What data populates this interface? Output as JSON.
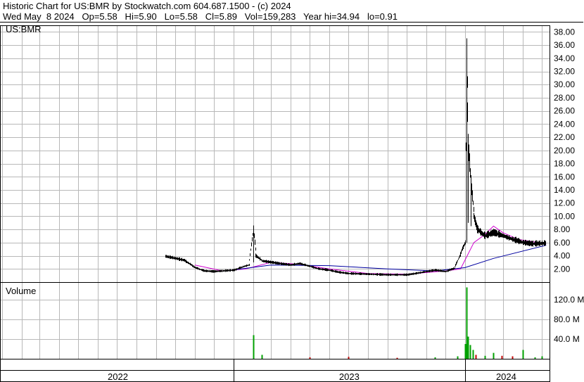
{
  "header": {
    "line1": "Historic Chart for US:BMR by Stockwatch.com 604.687.1500 - (c) 2024",
    "line2": "Wed May  8 2024   Op=5.58   Hi=5.90   Lo=5.58   Cl=5.89   Vol=159,283   Year hi=34.94   lo=0.91"
  },
  "price_panel": {
    "symbol_label": "US:BMR"
  },
  "volume_panel": {
    "label": "Volume"
  },
  "years": [
    "2022",
    "2023",
    "2024"
  ],
  "colors": {
    "price_bar": "#000000",
    "ma_short": "#d000d0",
    "ma_long": "#0000a0",
    "vol_up": "#00a000",
    "vol_down": "#c00000",
    "grid": "#b8b8b8"
  },
  "chart_data": [
    {
      "type": "bar",
      "title": "US:BMR",
      "subtype": "ohlc",
      "ylim": [
        0,
        39
      ],
      "yticks": [
        2.0,
        4.0,
        6.0,
        8.0,
        10.0,
        12.0,
        14.0,
        16.0,
        18.0,
        20.0,
        22.0,
        24.0,
        26.0,
        28.0,
        30.0,
        32.0,
        34.0,
        36.0,
        38.0
      ],
      "ytick_labels": [
        "2.00",
        "4.00",
        "6.00",
        "8.00",
        "10.00",
        "12.00",
        "14.00",
        "16.00",
        "18.00",
        "20.00",
        "22.00",
        "24.00",
        "26.00",
        "28.00",
        "30.00",
        "32.00",
        "34.00",
        "36.00",
        "38.00"
      ],
      "grid": true,
      "x_range": [
        "2022-01",
        "2024-05"
      ],
      "series": [
        {
          "key": "price",
          "points": [
            [
              "2022-09-15",
              3.9
            ],
            [
              "2022-10-01",
              3.6
            ],
            [
              "2022-10-15",
              3.3
            ],
            [
              "2022-11-01",
              2.2
            ],
            [
              "2022-11-15",
              1.7
            ],
            [
              "2022-12-01",
              1.6
            ],
            [
              "2022-12-15",
              1.7
            ],
            [
              "2023-01-01",
              1.8
            ],
            [
              "2023-01-15",
              2.3
            ],
            [
              "2023-01-25",
              2.6
            ],
            [
              "2023-02-01",
              8.0
            ],
            [
              "2023-02-05",
              4.0
            ],
            [
              "2023-02-15",
              3.2
            ],
            [
              "2023-03-01",
              3.0
            ],
            [
              "2023-03-15",
              2.8
            ],
            [
              "2023-04-01",
              2.6
            ],
            [
              "2023-04-15",
              2.8
            ],
            [
              "2023-05-01",
              2.4
            ],
            [
              "2023-05-15",
              2.0
            ],
            [
              "2023-06-01",
              1.8
            ],
            [
              "2023-06-15",
              1.5
            ],
            [
              "2023-07-01",
              1.3
            ],
            [
              "2023-08-01",
              1.2
            ],
            [
              "2023-09-01",
              1.1
            ],
            [
              "2023-10-01",
              1.1
            ],
            [
              "2023-10-15",
              1.3
            ],
            [
              "2023-11-01",
              1.6
            ],
            [
              "2023-11-15",
              1.8
            ],
            [
              "2023-12-01",
              1.6
            ],
            [
              "2023-12-15",
              2.1
            ],
            [
              "2024-01-01",
              6.0
            ],
            [
              "2024-01-03",
              34.94
            ],
            [
              "2024-01-06",
              21.0
            ],
            [
              "2024-01-10",
              15.0
            ],
            [
              "2024-01-15",
              10.0
            ],
            [
              "2024-01-20",
              8.0
            ],
            [
              "2024-02-01",
              7.0
            ],
            [
              "2024-02-15",
              7.5
            ],
            [
              "2024-03-01",
              7.0
            ],
            [
              "2024-03-15",
              6.5
            ],
            [
              "2024-04-01",
              6.0
            ],
            [
              "2024-04-15",
              5.8
            ],
            [
              "2024-05-08",
              5.89
            ]
          ]
        },
        {
          "key": "ma_short",
          "name": "",
          "points": [
            [
              "2022-11-01",
              2.6
            ],
            [
              "2022-12-15",
              1.7
            ],
            [
              "2023-01-20",
              2.0
            ],
            [
              "2023-03-01",
              3.0
            ],
            [
              "2023-04-15",
              2.7
            ],
            [
              "2023-06-01",
              2.0
            ],
            [
              "2023-08-01",
              1.3
            ],
            [
              "2023-10-01",
              1.2
            ],
            [
              "2023-12-01",
              1.7
            ],
            [
              "2023-12-25",
              2.0
            ],
            [
              "2024-01-15",
              6.0
            ],
            [
              "2024-02-01",
              7.2
            ],
            [
              "2024-02-15",
              8.5
            ],
            [
              "2024-03-01",
              7.5
            ],
            [
              "2024-03-25",
              6.5
            ],
            [
              "2024-05-08",
              5.8
            ]
          ]
        },
        {
          "key": "ma_long",
          "name": "",
          "points": [
            [
              "2022-12-20",
              1.7
            ],
            [
              "2023-03-01",
              2.6
            ],
            [
              "2023-06-01",
              2.5
            ],
            [
              "2023-09-01",
              2.0
            ],
            [
              "2023-11-15",
              1.7
            ],
            [
              "2024-01-01",
              2.2
            ],
            [
              "2024-02-15",
              3.6
            ],
            [
              "2024-05-08",
              5.6
            ]
          ]
        }
      ]
    },
    {
      "type": "bar",
      "title": "Volume",
      "ylim": [
        0,
        150
      ],
      "yticks": [
        40,
        80,
        120
      ],
      "ytick_labels": [
        "40.0 M",
        "80.0 M",
        "120.0 M"
      ],
      "grid": true,
      "series": [
        {
          "name": "",
          "points": [
            [
              "2023-02-01",
              48,
              "up"
            ],
            [
              "2023-02-15",
              8,
              "up"
            ],
            [
              "2023-05-01",
              3,
              "down"
            ],
            [
              "2023-07-01",
              4,
              "down"
            ],
            [
              "2023-09-15",
              2,
              "down"
            ],
            [
              "2023-11-15",
              3,
              "up"
            ],
            [
              "2023-12-20",
              5,
              "up"
            ],
            [
              "2024-01-01",
              30,
              "up"
            ],
            [
              "2024-01-03",
              145,
              "up"
            ],
            [
              "2024-01-06",
              45,
              "up"
            ],
            [
              "2024-01-09",
              28,
              "up"
            ],
            [
              "2024-01-13",
              18,
              "up"
            ],
            [
              "2024-01-18",
              8,
              "down"
            ],
            [
              "2024-02-01",
              6,
              "up"
            ],
            [
              "2024-02-15",
              12,
              "up"
            ],
            [
              "2024-02-28",
              6,
              "down"
            ],
            [
              "2024-03-15",
              5,
              "down"
            ],
            [
              "2024-04-01",
              18,
              "up"
            ],
            [
              "2024-04-20",
              3,
              "up"
            ],
            [
              "2024-05-01",
              5,
              "up"
            ]
          ]
        }
      ]
    }
  ]
}
